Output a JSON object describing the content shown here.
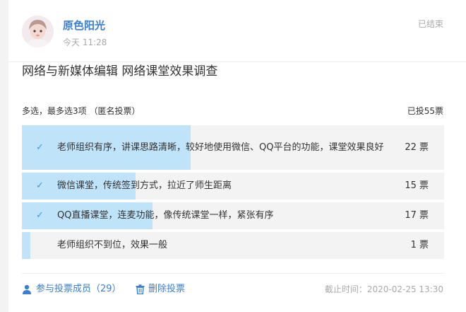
{
  "post": {
    "author": "原色阳光",
    "time": "今天 11:28",
    "status": "已结束"
  },
  "poll": {
    "title": "网络与新媒体编辑 网络课堂效果调查",
    "mode": "多选，最多选3项 （匿名投票）",
    "voted": "已投55票",
    "accent_color": "#3a9bdc",
    "fill_color": "#bfe3f9",
    "options": [
      {
        "label": "老师组织有序，讲课思路清晰，较好地使用微信、QQ平台的功能，课堂效果良好",
        "votes": "22 票",
        "fraction": 0.4,
        "checked": true
      },
      {
        "label": "微信课堂，传统签到方式，拉近了师生距离",
        "votes": "15 票",
        "fraction": 0.27,
        "checked": true
      },
      {
        "label": "QQ直播课堂，连麦功能，像传统课堂一样，紧张有序",
        "votes": "17 票",
        "fraction": 0.31,
        "checked": true
      },
      {
        "label": "老师组织不到位，效果一般",
        "votes": "1 票",
        "fraction": 0.02,
        "checked": false
      }
    ]
  },
  "footer": {
    "members": "参与投票成员（29）",
    "delete": "删除投票",
    "deadline": "截止时间：2020-02-25 13:30",
    "members_icon": "user-icon",
    "delete_icon": "trash-icon"
  }
}
